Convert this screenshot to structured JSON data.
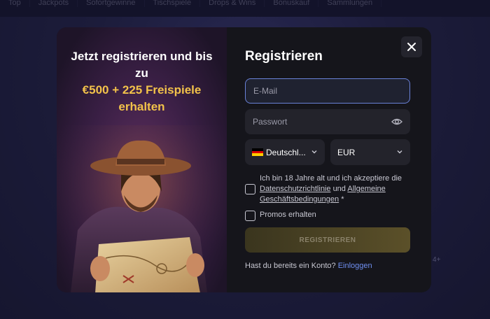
{
  "background": {
    "nav_items": [
      "Top",
      "Jackpots",
      "Sofortgewinne",
      "Tischspiele",
      "Drops & Wins",
      "Bonuskauf",
      "Sammlungen"
    ],
    "ghost_left": "",
    "ghost_right": "4+"
  },
  "promo": {
    "title_line1": "Jetzt registrieren und bis",
    "title_line2": "zu",
    "highlight_line1": "€500 + 225 Freispiele",
    "highlight_line2": "erhalten"
  },
  "form": {
    "title": "Registrieren",
    "email_placeholder": "E-Mail",
    "password_placeholder": "Passwort",
    "language_value": "Deutschl...",
    "currency_value": "EUR",
    "terms_prefix": "Ich bin 18 Jahre alt und ich akzeptiere die",
    "privacy_link": "Datenschutzrichtlinie",
    "terms_and": "und",
    "terms_link": "Allgemeine Geschäftsbedingungen",
    "terms_required": "*",
    "promos_label": "Promos erhalten",
    "register_label": "REGISTRIEREN",
    "login_prompt": "Hast du bereits ein Konto?",
    "login_link": "Einloggen"
  },
  "icons": {
    "close": "close-icon",
    "eye": "eye-icon",
    "chevron": "chevron-down-icon",
    "flag": "germany-flag-icon"
  },
  "colors": {
    "accent_gold": "#f2c24a",
    "link_blue": "#6f8ff0",
    "modal_bg": "#15151b",
    "field_bg": "#23232b",
    "focus_border": "#6a82d8"
  }
}
